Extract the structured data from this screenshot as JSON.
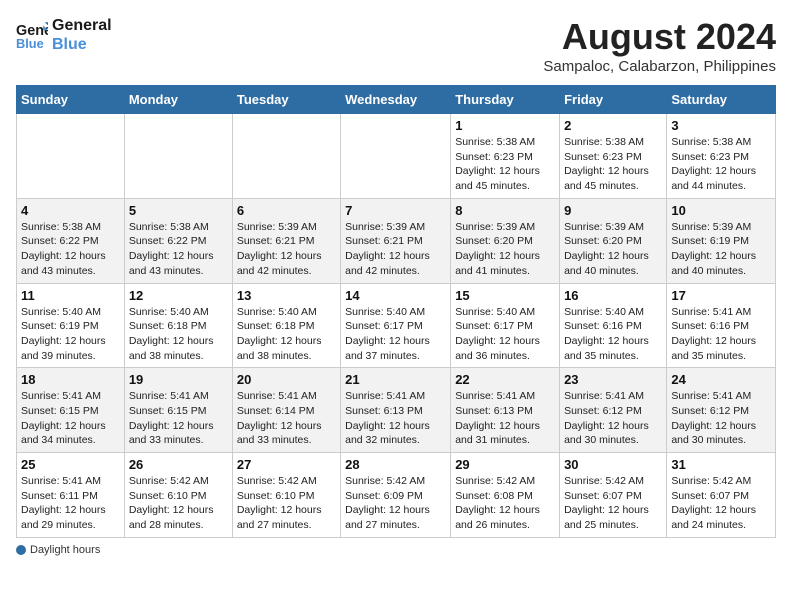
{
  "header": {
    "logo_line1": "General",
    "logo_line2": "Blue",
    "month_year": "August 2024",
    "location": "Sampaloc, Calabarzon, Philippines"
  },
  "weekdays": [
    "Sunday",
    "Monday",
    "Tuesday",
    "Wednesday",
    "Thursday",
    "Friday",
    "Saturday"
  ],
  "weeks": [
    [
      {
        "day": "",
        "info": ""
      },
      {
        "day": "",
        "info": ""
      },
      {
        "day": "",
        "info": ""
      },
      {
        "day": "",
        "info": ""
      },
      {
        "day": "1",
        "info": "Sunrise: 5:38 AM\nSunset: 6:23 PM\nDaylight: 12 hours\nand 45 minutes."
      },
      {
        "day": "2",
        "info": "Sunrise: 5:38 AM\nSunset: 6:23 PM\nDaylight: 12 hours\nand 45 minutes."
      },
      {
        "day": "3",
        "info": "Sunrise: 5:38 AM\nSunset: 6:23 PM\nDaylight: 12 hours\nand 44 minutes."
      }
    ],
    [
      {
        "day": "4",
        "info": "Sunrise: 5:38 AM\nSunset: 6:22 PM\nDaylight: 12 hours\nand 43 minutes."
      },
      {
        "day": "5",
        "info": "Sunrise: 5:38 AM\nSunset: 6:22 PM\nDaylight: 12 hours\nand 43 minutes."
      },
      {
        "day": "6",
        "info": "Sunrise: 5:39 AM\nSunset: 6:21 PM\nDaylight: 12 hours\nand 42 minutes."
      },
      {
        "day": "7",
        "info": "Sunrise: 5:39 AM\nSunset: 6:21 PM\nDaylight: 12 hours\nand 42 minutes."
      },
      {
        "day": "8",
        "info": "Sunrise: 5:39 AM\nSunset: 6:20 PM\nDaylight: 12 hours\nand 41 minutes."
      },
      {
        "day": "9",
        "info": "Sunrise: 5:39 AM\nSunset: 6:20 PM\nDaylight: 12 hours\nand 40 minutes."
      },
      {
        "day": "10",
        "info": "Sunrise: 5:39 AM\nSunset: 6:19 PM\nDaylight: 12 hours\nand 40 minutes."
      }
    ],
    [
      {
        "day": "11",
        "info": "Sunrise: 5:40 AM\nSunset: 6:19 PM\nDaylight: 12 hours\nand 39 minutes."
      },
      {
        "day": "12",
        "info": "Sunrise: 5:40 AM\nSunset: 6:18 PM\nDaylight: 12 hours\nand 38 minutes."
      },
      {
        "day": "13",
        "info": "Sunrise: 5:40 AM\nSunset: 6:18 PM\nDaylight: 12 hours\nand 38 minutes."
      },
      {
        "day": "14",
        "info": "Sunrise: 5:40 AM\nSunset: 6:17 PM\nDaylight: 12 hours\nand 37 minutes."
      },
      {
        "day": "15",
        "info": "Sunrise: 5:40 AM\nSunset: 6:17 PM\nDaylight: 12 hours\nand 36 minutes."
      },
      {
        "day": "16",
        "info": "Sunrise: 5:40 AM\nSunset: 6:16 PM\nDaylight: 12 hours\nand 35 minutes."
      },
      {
        "day": "17",
        "info": "Sunrise: 5:41 AM\nSunset: 6:16 PM\nDaylight: 12 hours\nand 35 minutes."
      }
    ],
    [
      {
        "day": "18",
        "info": "Sunrise: 5:41 AM\nSunset: 6:15 PM\nDaylight: 12 hours\nand 34 minutes."
      },
      {
        "day": "19",
        "info": "Sunrise: 5:41 AM\nSunset: 6:15 PM\nDaylight: 12 hours\nand 33 minutes."
      },
      {
        "day": "20",
        "info": "Sunrise: 5:41 AM\nSunset: 6:14 PM\nDaylight: 12 hours\nand 33 minutes."
      },
      {
        "day": "21",
        "info": "Sunrise: 5:41 AM\nSunset: 6:13 PM\nDaylight: 12 hours\nand 32 minutes."
      },
      {
        "day": "22",
        "info": "Sunrise: 5:41 AM\nSunset: 6:13 PM\nDaylight: 12 hours\nand 31 minutes."
      },
      {
        "day": "23",
        "info": "Sunrise: 5:41 AM\nSunset: 6:12 PM\nDaylight: 12 hours\nand 30 minutes."
      },
      {
        "day": "24",
        "info": "Sunrise: 5:41 AM\nSunset: 6:12 PM\nDaylight: 12 hours\nand 30 minutes."
      }
    ],
    [
      {
        "day": "25",
        "info": "Sunrise: 5:41 AM\nSunset: 6:11 PM\nDaylight: 12 hours\nand 29 minutes."
      },
      {
        "day": "26",
        "info": "Sunrise: 5:42 AM\nSunset: 6:10 PM\nDaylight: 12 hours\nand 28 minutes."
      },
      {
        "day": "27",
        "info": "Sunrise: 5:42 AM\nSunset: 6:10 PM\nDaylight: 12 hours\nand 27 minutes."
      },
      {
        "day": "28",
        "info": "Sunrise: 5:42 AM\nSunset: 6:09 PM\nDaylight: 12 hours\nand 27 minutes."
      },
      {
        "day": "29",
        "info": "Sunrise: 5:42 AM\nSunset: 6:08 PM\nDaylight: 12 hours\nand 26 minutes."
      },
      {
        "day": "30",
        "info": "Sunrise: 5:42 AM\nSunset: 6:07 PM\nDaylight: 12 hours\nand 25 minutes."
      },
      {
        "day": "31",
        "info": "Sunrise: 5:42 AM\nSunset: 6:07 PM\nDaylight: 12 hours\nand 24 minutes."
      }
    ]
  ],
  "footer": {
    "daylight_label": "Daylight hours"
  }
}
